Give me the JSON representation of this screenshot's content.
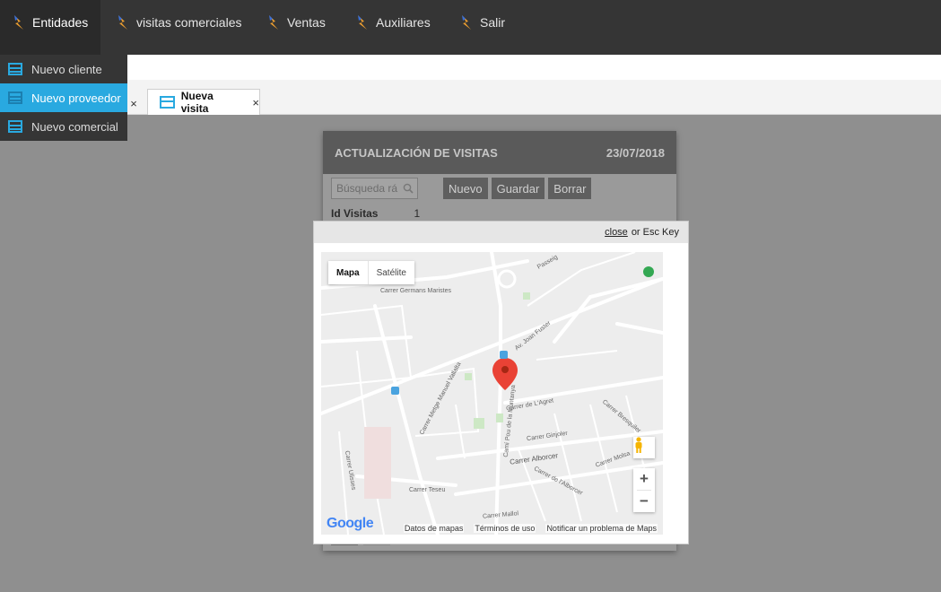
{
  "menu": {
    "items": [
      {
        "label": "Entidades"
      },
      {
        "label": "visitas comerciales"
      },
      {
        "label": "Ventas"
      },
      {
        "label": "Auxiliares"
      },
      {
        "label": "Salir"
      }
    ]
  },
  "dropdown": {
    "items": [
      {
        "label": "Nuevo cliente"
      },
      {
        "label": "Nuevo proveedor"
      },
      {
        "label": "Nuevo comercial"
      }
    ]
  },
  "tabs": {
    "prev_close": "×",
    "active": {
      "label": "Nueva visita",
      "close": "×"
    }
  },
  "form": {
    "title": "ACTUALIZACIÓN DE VISITAS",
    "date": "23/07/2018",
    "search_placeholder": "Búsqueda rá",
    "buttons": {
      "new": "Nuevo",
      "save": "Guardar",
      "delete": "Borrar"
    },
    "id_label": "Id Visitas",
    "id_value": "1"
  },
  "modal": {
    "close_link": "close",
    "close_suffix": "or Esc Key"
  },
  "map": {
    "type_map": "Mapa",
    "type_satellite": "Satélite",
    "zoom_in": "+",
    "zoom_out": "−",
    "logo": "Google",
    "footer": {
      "data": "Datos de mapas",
      "terms": "Términos de uso",
      "report": "Notificar un problema de Maps"
    },
    "streets": {
      "s1": "Carrer Germans Maristes",
      "s2": "Av. Joan Fuster",
      "s3": "Carrer Metge Manuel Vallalta",
      "s4": "Camí Pou de la Muntanya",
      "s5": "Carrer de L'Agret",
      "s6": "Carrer Ginjoler",
      "s7": "Carrer Alborcer",
      "s8": "Carrer de l'Alborcer",
      "s9": "Carrer Teseu",
      "s10": "Carrer Ulisses",
      "s11": "Carrer Mallol",
      "s12": "Passeig",
      "s13": "Carrer Bresquiler",
      "s14": "Carrer Molsa"
    }
  }
}
